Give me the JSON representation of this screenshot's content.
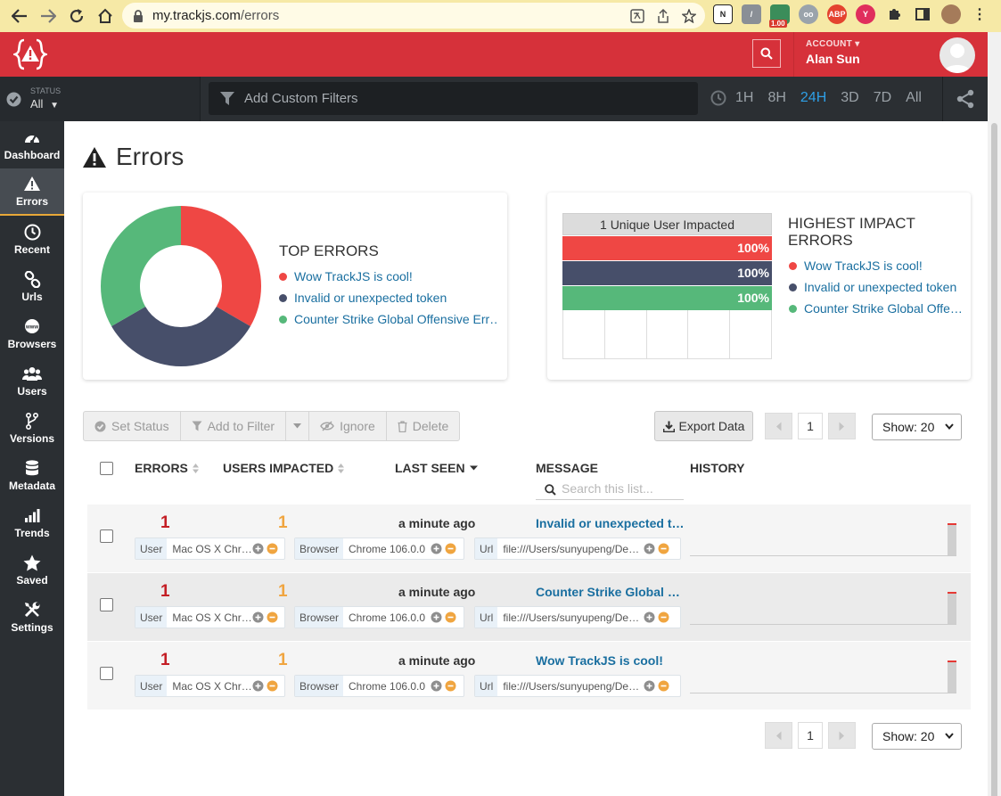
{
  "browser": {
    "url_host": "my.trackjs.com",
    "url_path": "/errors",
    "ext_badge": "1.00"
  },
  "header": {
    "account_label": "ACCOUNT",
    "account_name": "Alan Sun"
  },
  "filterbar": {
    "status_label": "STATUS",
    "status_value": "All",
    "filter_placeholder": "Add Custom Filters",
    "time_ranges": [
      "1H",
      "8H",
      "24H",
      "3D",
      "7D",
      "All"
    ],
    "active_time_range": "24H"
  },
  "sidebar": {
    "items": [
      {
        "label": "Dashboard",
        "icon": "gauge-icon"
      },
      {
        "label": "Errors",
        "icon": "warning-icon",
        "active": true
      },
      {
        "label": "Recent",
        "icon": "clock-icon"
      },
      {
        "label": "Urls",
        "icon": "link-icon"
      },
      {
        "label": "Browsers",
        "icon": "www-icon"
      },
      {
        "label": "Users",
        "icon": "users-icon"
      },
      {
        "label": "Versions",
        "icon": "branch-icon"
      },
      {
        "label": "Metadata",
        "icon": "database-icon"
      },
      {
        "label": "Trends",
        "icon": "signal-icon"
      },
      {
        "label": "Saved",
        "icon": "star-icon"
      },
      {
        "label": "Settings",
        "icon": "tools-icon"
      }
    ]
  },
  "page": {
    "title": "Errors"
  },
  "top_errors": {
    "title": "TOP ERRORS",
    "items": [
      {
        "label": "Wow TrackJS is cool!",
        "color": "#ef4744"
      },
      {
        "label": "Invalid or unexpected token",
        "color": "#474f6a"
      },
      {
        "label": "Counter Strike Global Offensive Err…",
        "color": "#56b87a"
      }
    ]
  },
  "highest_impact": {
    "title_line1": "HIGHEST IMPACT",
    "title_line2": "ERRORS",
    "header": "1 Unique User Impacted",
    "items": [
      {
        "label": "Wow TrackJS is cool!",
        "color": "#ef4744"
      },
      {
        "label": "Invalid or unexpected token",
        "color": "#474f6a"
      },
      {
        "label": "Counter Strike Global Offe…",
        "color": "#56b87a"
      }
    ]
  },
  "chart_data": [
    {
      "type": "pie",
      "title": "TOP ERRORS",
      "categories": [
        "Wow TrackJS is cool!",
        "Invalid or unexpected token",
        "Counter Strike Global Offensive Err…"
      ],
      "values": [
        1,
        1,
        1
      ],
      "colors": [
        "#ef4744",
        "#474f6a",
        "#56b87a"
      ],
      "legend": "right"
    },
    {
      "type": "bar",
      "title": "1 Unique User Impacted",
      "categories": [
        "Wow TrackJS is cool!",
        "Invalid or unexpected token",
        "Counter Strike Global Offe…"
      ],
      "values": [
        100,
        100,
        100
      ],
      "labels": [
        "100%",
        "100%",
        "100%"
      ],
      "colors": [
        "#ef4744",
        "#474f6a",
        "#56b87a"
      ],
      "ylim": [
        0,
        100
      ],
      "legend": "right"
    }
  ],
  "toolbar": {
    "set_status": "Set Status",
    "add_to_filter": "Add to Filter",
    "ignore": "Ignore",
    "delete": "Delete",
    "export": "Export Data"
  },
  "pagination": {
    "page": "1",
    "show": "Show: 20"
  },
  "table": {
    "columns": {
      "errors": "ERRORS",
      "users": "USERS IMPACTED",
      "last_seen": "LAST SEEN",
      "message": "MESSAGE",
      "history": "HISTORY"
    },
    "search_placeholder": "Search this list...",
    "rows": [
      {
        "errors": "1",
        "users": "1",
        "last_seen": "a minute ago",
        "message": "Invalid or unexpected to…",
        "user_key": "User",
        "user_val": "Mac OS X Chr…",
        "browser_key": "Browser",
        "browser_val": "Chrome 106.0.0",
        "url_key": "Url",
        "url_val": "file:///Users/sunyupeng/De…"
      },
      {
        "errors": "1",
        "users": "1",
        "last_seen": "a minute ago",
        "message": "Counter Strike Global Of…",
        "user_key": "User",
        "user_val": "Mac OS X Chr…",
        "browser_key": "Browser",
        "browser_val": "Chrome 106.0.0",
        "url_key": "Url",
        "url_val": "file:///Users/sunyupeng/De…"
      },
      {
        "errors": "1",
        "users": "1",
        "last_seen": "a minute ago",
        "message": "Wow TrackJS is cool!",
        "user_key": "User",
        "user_val": "Mac OS X Chr…",
        "browser_key": "Browser",
        "browser_val": "Chrome 106.0.0",
        "url_key": "Url",
        "url_val": "file:///Users/sunyupeng/De…"
      }
    ]
  },
  "colors": {
    "brand_red": "#d6313a",
    "link_blue": "#1a6fa0",
    "active_time": "#2e9fe6",
    "error_count": "#c41e25",
    "user_count": "#f0a540"
  }
}
